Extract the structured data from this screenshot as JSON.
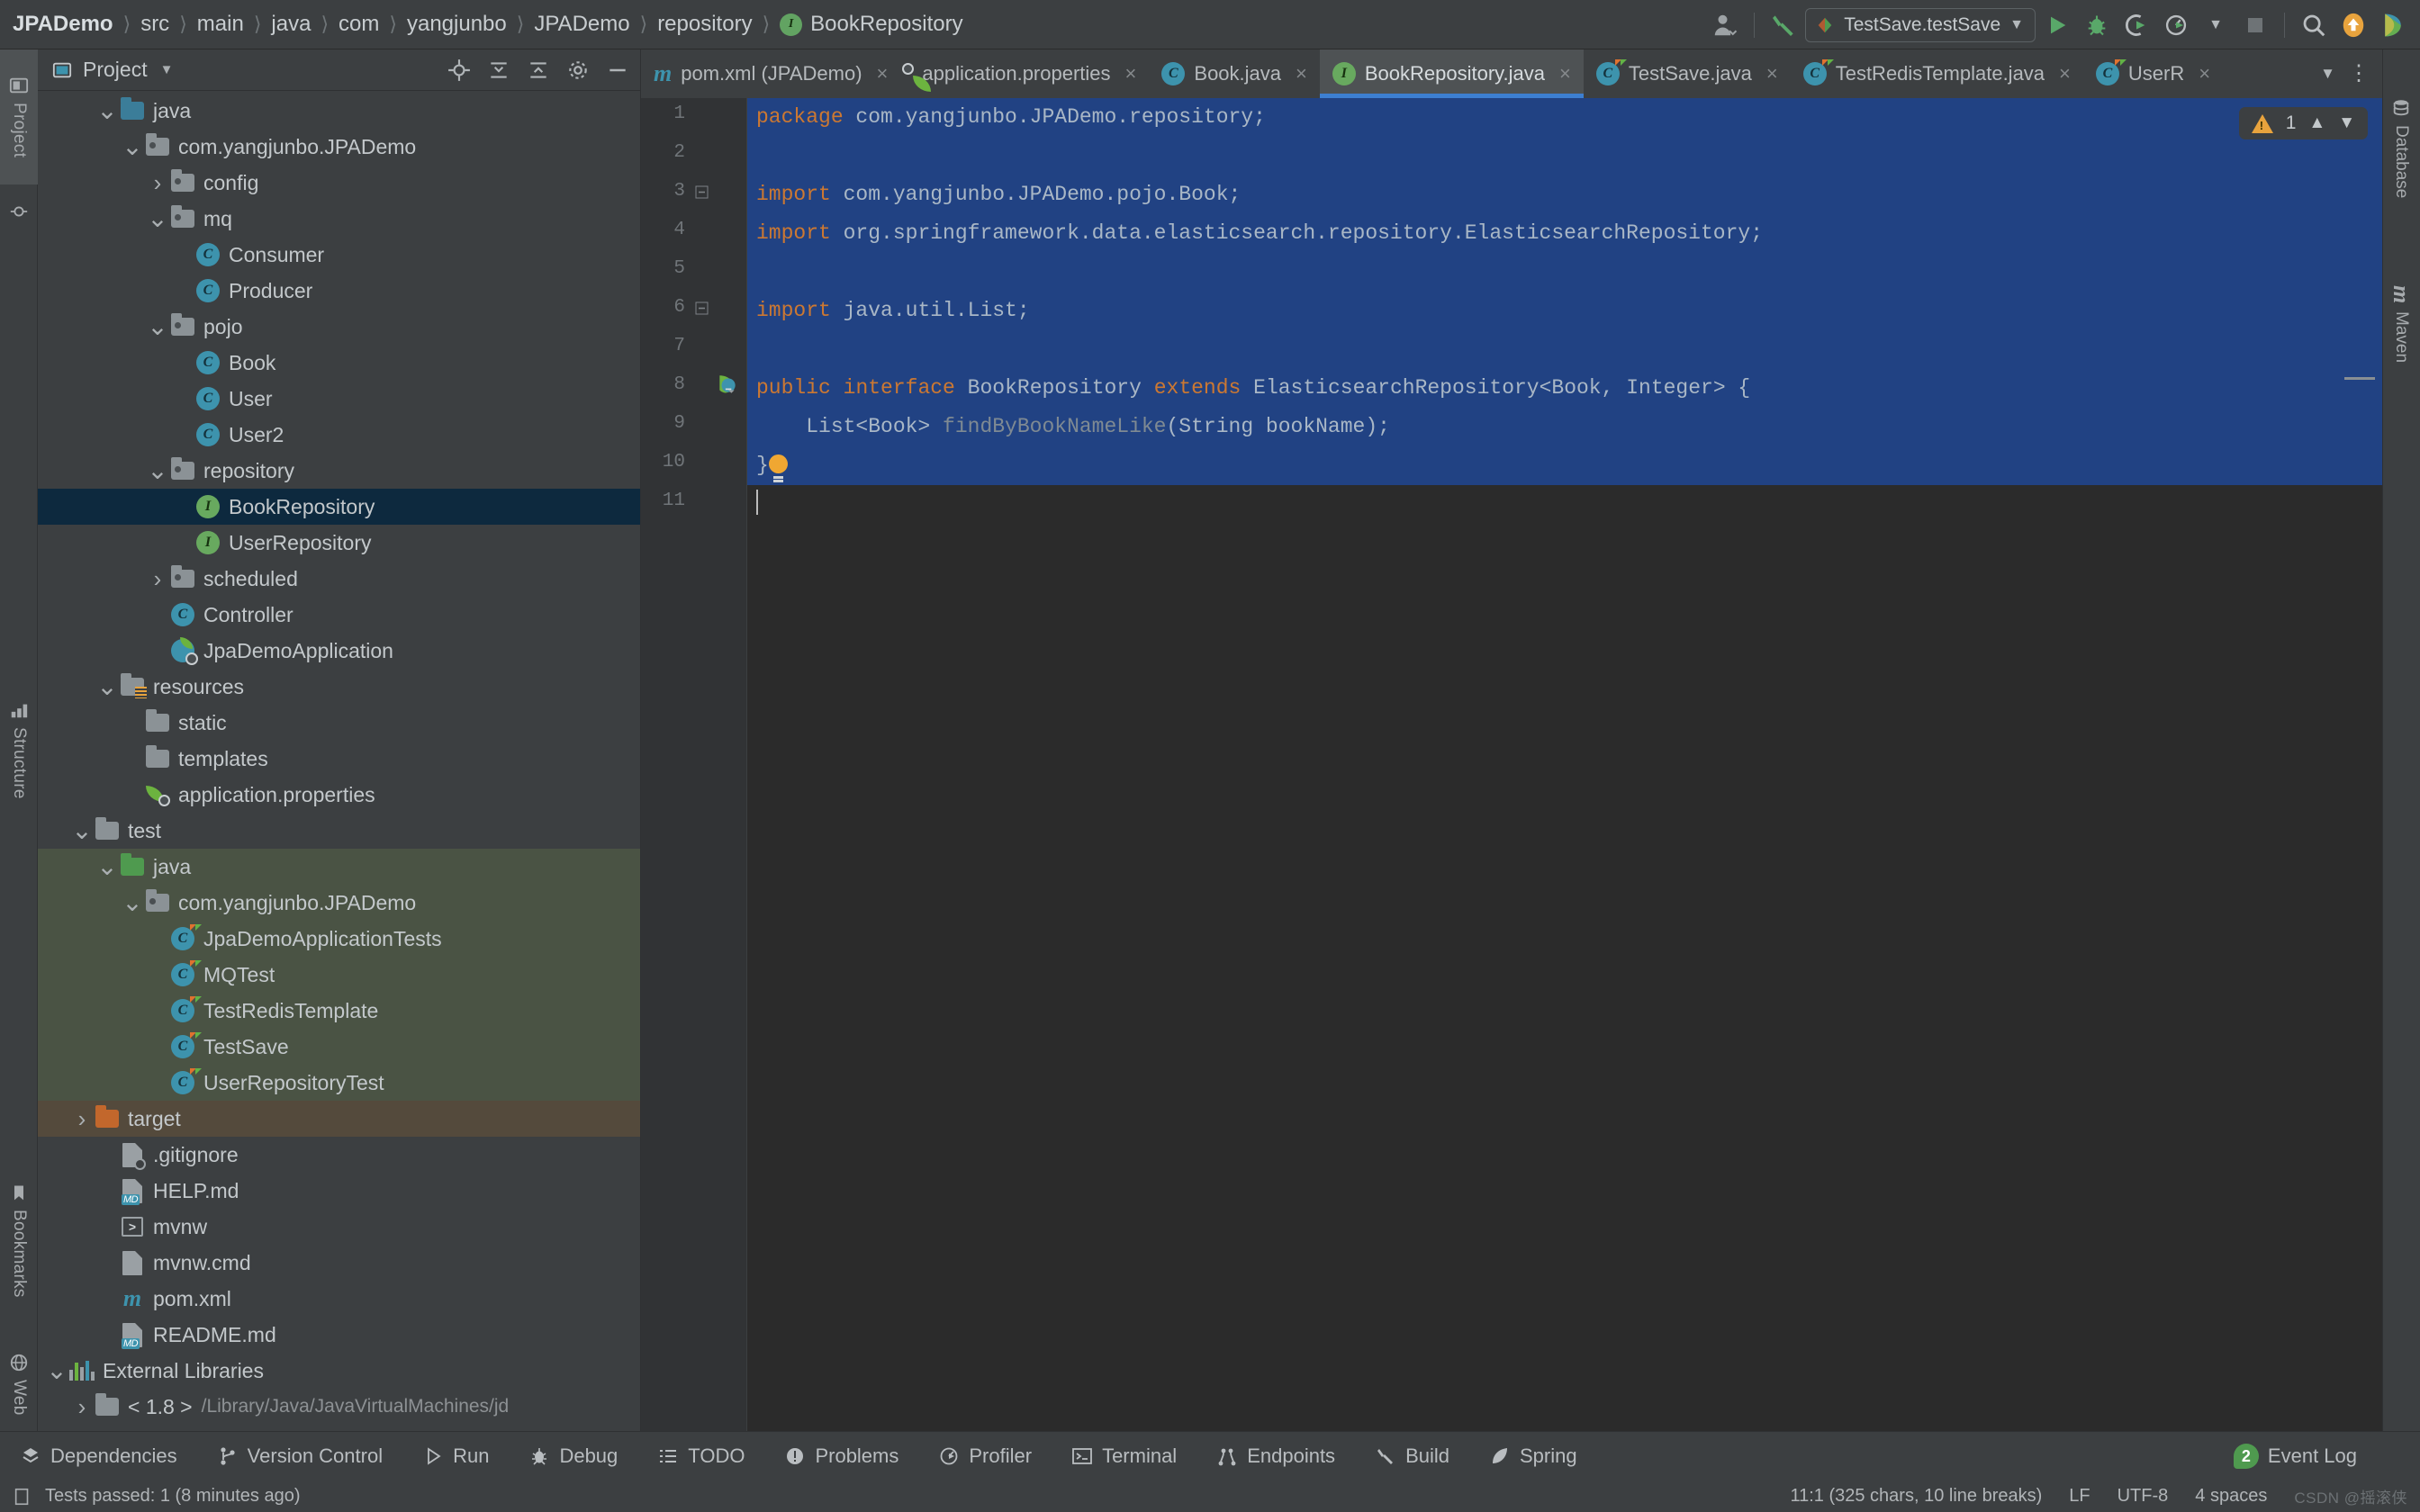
{
  "breadcrumb": {
    "items": [
      "JPADemo",
      "src",
      "main",
      "java",
      "com",
      "yangjunbo",
      "JPADemo",
      "repository"
    ],
    "current": "BookRepository"
  },
  "toolbar": {
    "run_config": "TestSave.testSave",
    "icons": [
      "user-avatar-icon",
      "build-hammer-icon",
      "run-icon",
      "debug-icon",
      "run-with-coverage-icon",
      "profile-icon",
      "stop-icon",
      "search-everywhere-icon",
      "update-project-icon",
      "feedback-icon"
    ]
  },
  "left_strip": {
    "tabs": [
      "Project",
      "Structure",
      "Bookmarks",
      "Web"
    ]
  },
  "right_strip": {
    "tabs": [
      "Database",
      "Maven"
    ]
  },
  "project_panel": {
    "title": "Project",
    "tree": [
      {
        "label": "java",
        "indent": 2,
        "icon": "folder-blue",
        "twisty": "down"
      },
      {
        "label": "com.yangjunbo.JPADemo",
        "indent": 3,
        "icon": "folder-package",
        "twisty": "down"
      },
      {
        "label": "config",
        "indent": 4,
        "icon": "folder-package",
        "twisty": "right"
      },
      {
        "label": "mq",
        "indent": 4,
        "icon": "folder-package",
        "twisty": "down"
      },
      {
        "label": "Consumer",
        "indent": 5,
        "icon": "class",
        "twisty": ""
      },
      {
        "label": "Producer",
        "indent": 5,
        "icon": "class",
        "twisty": ""
      },
      {
        "label": "pojo",
        "indent": 4,
        "icon": "folder-package",
        "twisty": "down"
      },
      {
        "label": "Book",
        "indent": 5,
        "icon": "class",
        "twisty": ""
      },
      {
        "label": "User",
        "indent": 5,
        "icon": "class",
        "twisty": ""
      },
      {
        "label": "User2",
        "indent": 5,
        "icon": "class",
        "twisty": ""
      },
      {
        "label": "repository",
        "indent": 4,
        "icon": "folder-package",
        "twisty": "down"
      },
      {
        "label": "BookRepository",
        "indent": 5,
        "icon": "interface",
        "twisty": "",
        "selected": true
      },
      {
        "label": "UserRepository",
        "indent": 5,
        "icon": "interface",
        "twisty": ""
      },
      {
        "label": "scheduled",
        "indent": 4,
        "icon": "folder-package",
        "twisty": "right"
      },
      {
        "label": "Controller",
        "indent": 4,
        "icon": "class",
        "twisty": ""
      },
      {
        "label": "JpaDemoApplication",
        "indent": 4,
        "icon": "spring-boot-app",
        "twisty": ""
      },
      {
        "label": "resources",
        "indent": 2,
        "icon": "folder-resources",
        "twisty": "down"
      },
      {
        "label": "static",
        "indent": 3,
        "icon": "folder-plain",
        "twisty": ""
      },
      {
        "label": "templates",
        "indent": 3,
        "icon": "folder-plain",
        "twisty": ""
      },
      {
        "label": "application.properties",
        "indent": 3,
        "icon": "spring-properties",
        "twisty": ""
      },
      {
        "label": "test",
        "indent": 1,
        "icon": "folder-plain",
        "twisty": "down"
      },
      {
        "label": "java",
        "indent": 2,
        "icon": "folder-green",
        "twisty": "down",
        "bg": "green"
      },
      {
        "label": "com.yangjunbo.JPADemo",
        "indent": 3,
        "icon": "folder-package",
        "twisty": "down",
        "bg": "green"
      },
      {
        "label": "JpaDemoApplicationTests",
        "indent": 4,
        "icon": "test-class",
        "twisty": "",
        "bg": "green"
      },
      {
        "label": "MQTest",
        "indent": 4,
        "icon": "test-class",
        "twisty": "",
        "bg": "green"
      },
      {
        "label": "TestRedisTemplate",
        "indent": 4,
        "icon": "test-class",
        "twisty": "",
        "bg": "green"
      },
      {
        "label": "TestSave",
        "indent": 4,
        "icon": "test-class",
        "twisty": "",
        "bg": "green"
      },
      {
        "label": "UserRepositoryTest",
        "indent": 4,
        "icon": "test-class",
        "twisty": "",
        "bg": "green"
      },
      {
        "label": "target",
        "indent": 1,
        "icon": "folder-orange",
        "twisty": "right",
        "bg": "brown"
      },
      {
        "label": ".gitignore",
        "indent": 2,
        "icon": "gitignore-file",
        "twisty": ""
      },
      {
        "label": "HELP.md",
        "indent": 2,
        "icon": "markdown-file",
        "twisty": ""
      },
      {
        "label": "mvnw",
        "indent": 2,
        "icon": "shell-file",
        "twisty": ""
      },
      {
        "label": "mvnw.cmd",
        "indent": 2,
        "icon": "text-file",
        "twisty": ""
      },
      {
        "label": "pom.xml",
        "indent": 2,
        "icon": "maven-file",
        "twisty": ""
      },
      {
        "label": "README.md",
        "indent": 2,
        "icon": "markdown-file",
        "twisty": ""
      },
      {
        "label": "External Libraries",
        "indent": 0,
        "icon": "libraries",
        "twisty": "down"
      },
      {
        "label": "< 1.8 >",
        "indent": 1,
        "icon": "folder-plain",
        "twisty": "right",
        "sub": "/Library/Java/JavaVirtualMachines/jd"
      }
    ]
  },
  "editor": {
    "tabs": [
      {
        "label": "pom.xml (JPADemo)",
        "icon": "maven-file",
        "active": false
      },
      {
        "label": "application.properties",
        "icon": "spring-properties",
        "active": false
      },
      {
        "label": "Book.java",
        "icon": "class",
        "active": false
      },
      {
        "label": "BookRepository.java",
        "icon": "interface",
        "active": true
      },
      {
        "label": "TestSave.java",
        "icon": "test-class",
        "active": false
      },
      {
        "label": "TestRedisTemplate.java",
        "icon": "test-class",
        "active": false
      },
      {
        "label": "UserR",
        "icon": "test-class",
        "active": false
      }
    ],
    "line_numbers": [
      "1",
      "2",
      "3",
      "4",
      "5",
      "6",
      "7",
      "8",
      "9",
      "10",
      "11"
    ],
    "code_lines": [
      {
        "n": 1,
        "parts": [
          {
            "t": "package",
            "c": "kw"
          },
          {
            "t": " com.yangjunbo.JPADemo.repository;",
            "c": "txt"
          }
        ],
        "hl": true
      },
      {
        "n": 2,
        "parts": [],
        "hl": true
      },
      {
        "n": 3,
        "parts": [
          {
            "t": "import",
            "c": "kw"
          },
          {
            "t": " com.yangjunbo.JPADemo.pojo.Book;",
            "c": "txt"
          }
        ],
        "hl": true,
        "fold": "minus"
      },
      {
        "n": 4,
        "parts": [
          {
            "t": "import",
            "c": "kw"
          },
          {
            "t": " org.springframework.data.elasticsearch.repository.ElasticsearchRepository;",
            "c": "txt"
          }
        ],
        "hl": true
      },
      {
        "n": 5,
        "parts": [],
        "hl": true
      },
      {
        "n": 6,
        "parts": [
          {
            "t": "import",
            "c": "kw"
          },
          {
            "t": " java.util.List;",
            "c": "txt"
          }
        ],
        "hl": true,
        "fold": "minus"
      },
      {
        "n": 7,
        "parts": [],
        "hl": true
      },
      {
        "n": 8,
        "parts": [
          {
            "t": "public",
            "c": "kw"
          },
          {
            "t": " ",
            "c": "txt"
          },
          {
            "t": "interface",
            "c": "kw"
          },
          {
            "t": " BookRepository ",
            "c": "txt"
          },
          {
            "t": "extends",
            "c": "kw"
          },
          {
            "t": " ElasticsearchRepository<Book, Integer> {",
            "c": "txt"
          }
        ],
        "hl": true,
        "marker": "spring-bean-icon"
      },
      {
        "n": 9,
        "parts": [
          {
            "t": "    List<Book> ",
            "c": "txt"
          },
          {
            "t": "findByBookNameLike",
            "c": "meth"
          },
          {
            "t": "(String bookName);",
            "c": "txt"
          }
        ],
        "hl": true
      },
      {
        "n": 10,
        "parts": [
          {
            "t": "}",
            "c": "txt"
          }
        ],
        "hl": true,
        "bulb": true
      },
      {
        "n": 11,
        "parts": [],
        "hl": false,
        "caret": true
      }
    ],
    "inspection": {
      "warning_count": "1"
    }
  },
  "bottom_bar": {
    "items": [
      {
        "label": "Dependencies",
        "icon": "dependencies-icon"
      },
      {
        "label": "Version Control",
        "icon": "vcs-branch-icon"
      },
      {
        "label": "Run",
        "icon": "run-icon"
      },
      {
        "label": "Debug",
        "icon": "debug-icon"
      },
      {
        "label": "TODO",
        "icon": "todo-list-icon"
      },
      {
        "label": "Problems",
        "icon": "problems-icon"
      },
      {
        "label": "Profiler",
        "icon": "profiler-icon"
      },
      {
        "label": "Terminal",
        "icon": "terminal-icon"
      },
      {
        "label": "Endpoints",
        "icon": "endpoints-icon"
      },
      {
        "label": "Build",
        "icon": "build-hammer-icon"
      },
      {
        "label": "Spring",
        "icon": "spring-leaf-icon"
      }
    ],
    "event_log": {
      "label": "Event Log",
      "count": "2"
    }
  },
  "status_bar": {
    "message": "Tests passed: 1 (8 minutes ago)",
    "caret_position": "11:1 (325 chars, 10 line breaks)",
    "line_separator": "LF",
    "encoding": "UTF-8",
    "indent": "4 spaces",
    "watermark": "CSDN @摇滚侠"
  },
  "colors": {
    "selection_blue": "#214283",
    "tab_underline": "#3d7fd1",
    "tree_selected": "#0d293e",
    "test_source_bg": "#4a5344",
    "target_bg": "#544a3c",
    "keyword_orange": "#cc7832",
    "interface_green": "#68a95f",
    "class_blue": "#3d93ad",
    "warning_yellow": "#e8a33d"
  }
}
